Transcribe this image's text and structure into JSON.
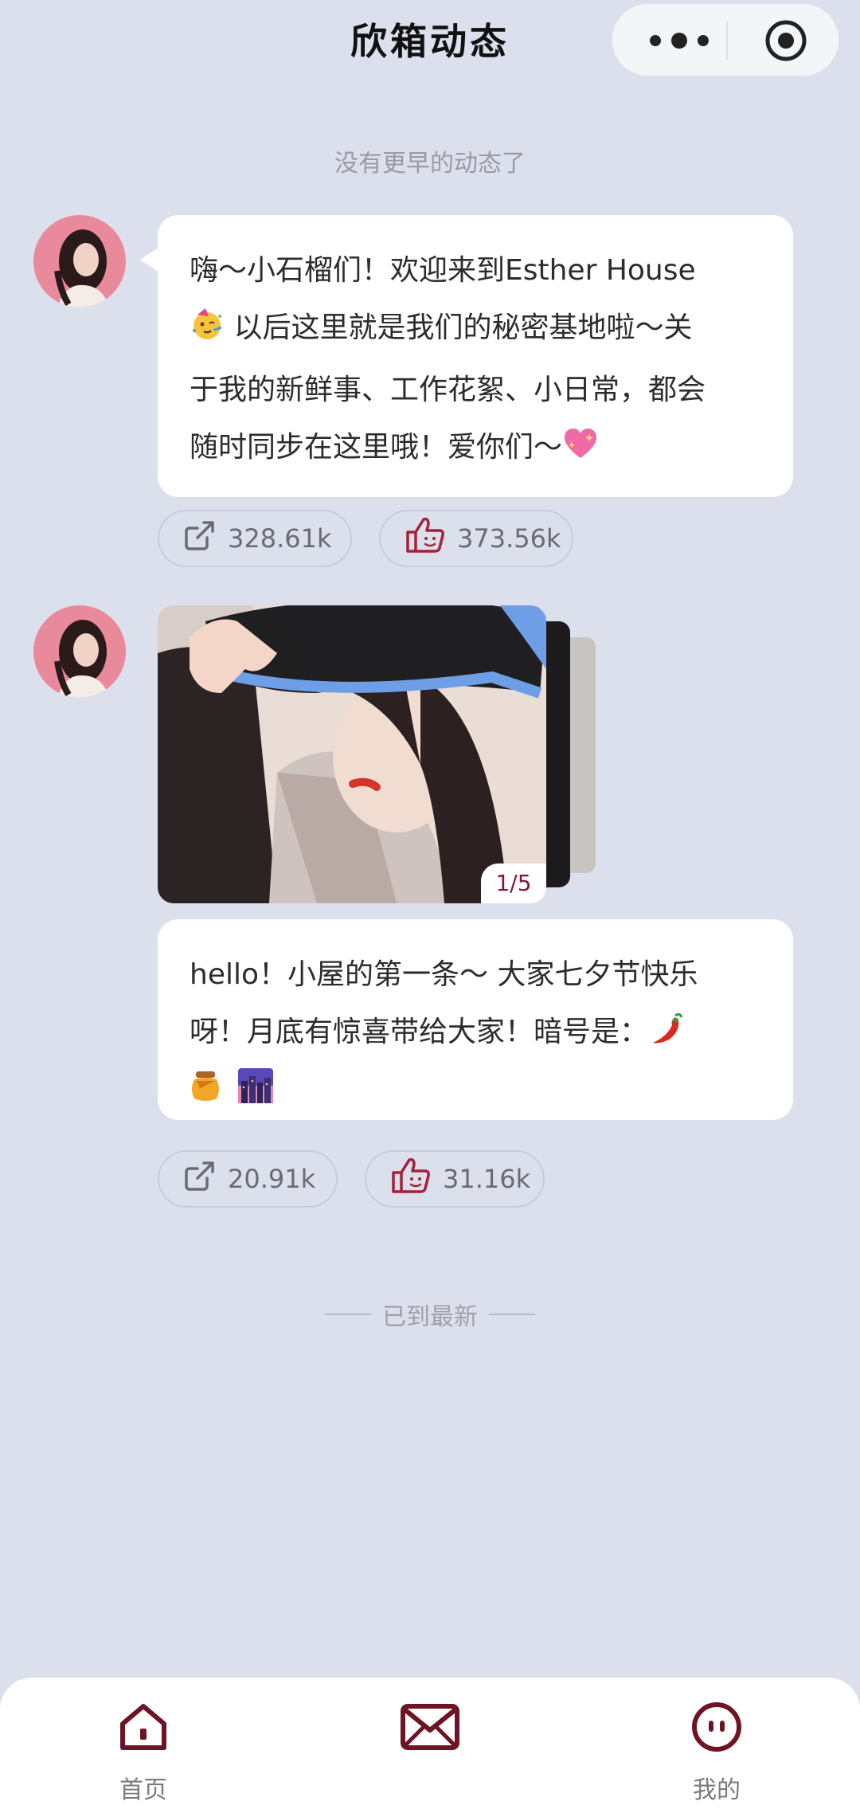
{
  "header": {
    "title": "欣箱动态"
  },
  "feed": {
    "top_hint": "没有更早的动态了",
    "bottom_hint": "已到最新",
    "posts": [
      {
        "text_lines": [
          "嗨～小石榴们！欢迎来到Esther House",
          "以后这里就是我们的秘密基地啦～关",
          "于我的新鲜事、工作花絮、小日常，都会",
          "随时同步在这里哦！爱你们～"
        ],
        "share_count": "328.61k",
        "like_count": "373.56k"
      },
      {
        "image_counter": "1/5",
        "text_lines": [
          "hello！小屋的第一条～ 大家七夕节快乐",
          "呀！月底有惊喜带给大家！暗号是："
        ],
        "share_count": "20.91k",
        "like_count": "31.16k"
      }
    ]
  },
  "tabbar": {
    "items": [
      {
        "label": "首页",
        "icon": "home-icon"
      },
      {
        "label": "",
        "icon": "mail-icon"
      },
      {
        "label": "我的",
        "icon": "profile-icon"
      }
    ]
  },
  "colors": {
    "accent": "#7b1b2b",
    "background": "#dcdfec"
  }
}
